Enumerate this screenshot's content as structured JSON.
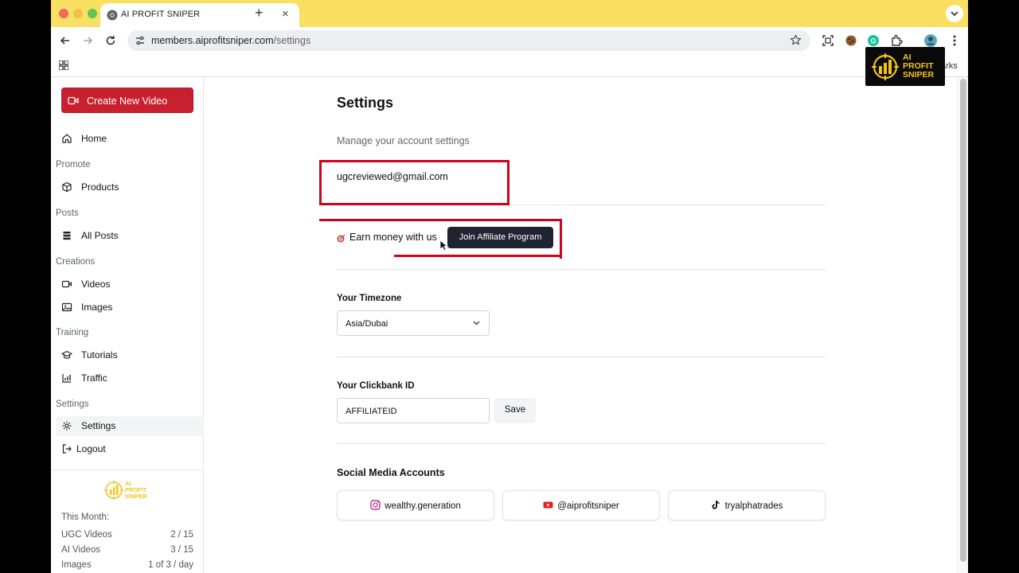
{
  "browser": {
    "tab_title": "AI PROFIT SNIPER",
    "tab_close": "×",
    "new_tab": "+",
    "url_domain": "members.aiprofitsniper.com",
    "url_path": "/settings",
    "bookmarks_fragment": "arks"
  },
  "sidebar": {
    "create_button": "Create New Video",
    "home": "Home",
    "sections": {
      "promote": "Promote",
      "posts": "Posts",
      "creations": "Creations",
      "training": "Training",
      "settings": "Settings"
    },
    "items": {
      "products": "Products",
      "all_posts": "All Posts",
      "videos": "Videos",
      "images": "Images",
      "tutorials": "Tutorials",
      "traffic": "Traffic",
      "settings": "Settings",
      "logout": "Logout"
    },
    "logo_text": [
      "AI",
      "PROFIT",
      "SNIPER"
    ],
    "usage_title": "This Month:",
    "usage": [
      {
        "label": "UGC Videos",
        "value": "2 / 15"
      },
      {
        "label": "AI Videos",
        "value": "3 / 15"
      },
      {
        "label": "Images",
        "value": "1 of 3 / day"
      }
    ]
  },
  "main": {
    "title": "Settings",
    "subtitle": "Manage your account settings",
    "email": "ugcreviewed@gmail.com",
    "earn_text": "Earn money with us",
    "join_button": "Join Affiliate Program",
    "timezone_label": "Your Timezone",
    "timezone_value": "Asia/Dubai",
    "clickbank_label": "Your Clickbank ID",
    "clickbank_value": "AFFILIATEID",
    "save_button": "Save",
    "social_title": "Social Media Accounts",
    "social": [
      {
        "network": "instagram",
        "handle": "wealthy.generation"
      },
      {
        "network": "youtube",
        "handle": "@aiprofitsniper"
      },
      {
        "network": "tiktok",
        "handle": "tryalphatrades"
      }
    ]
  },
  "overlay_logo": [
    "AI",
    "PROFIT",
    "SNIPER"
  ],
  "colors": {
    "tab_strip": "#f9df62",
    "brand_red": "#c8202f",
    "annotation_red": "#d0021b",
    "dark_button": "#1f2430",
    "logo_gold": "#f3c41c"
  }
}
